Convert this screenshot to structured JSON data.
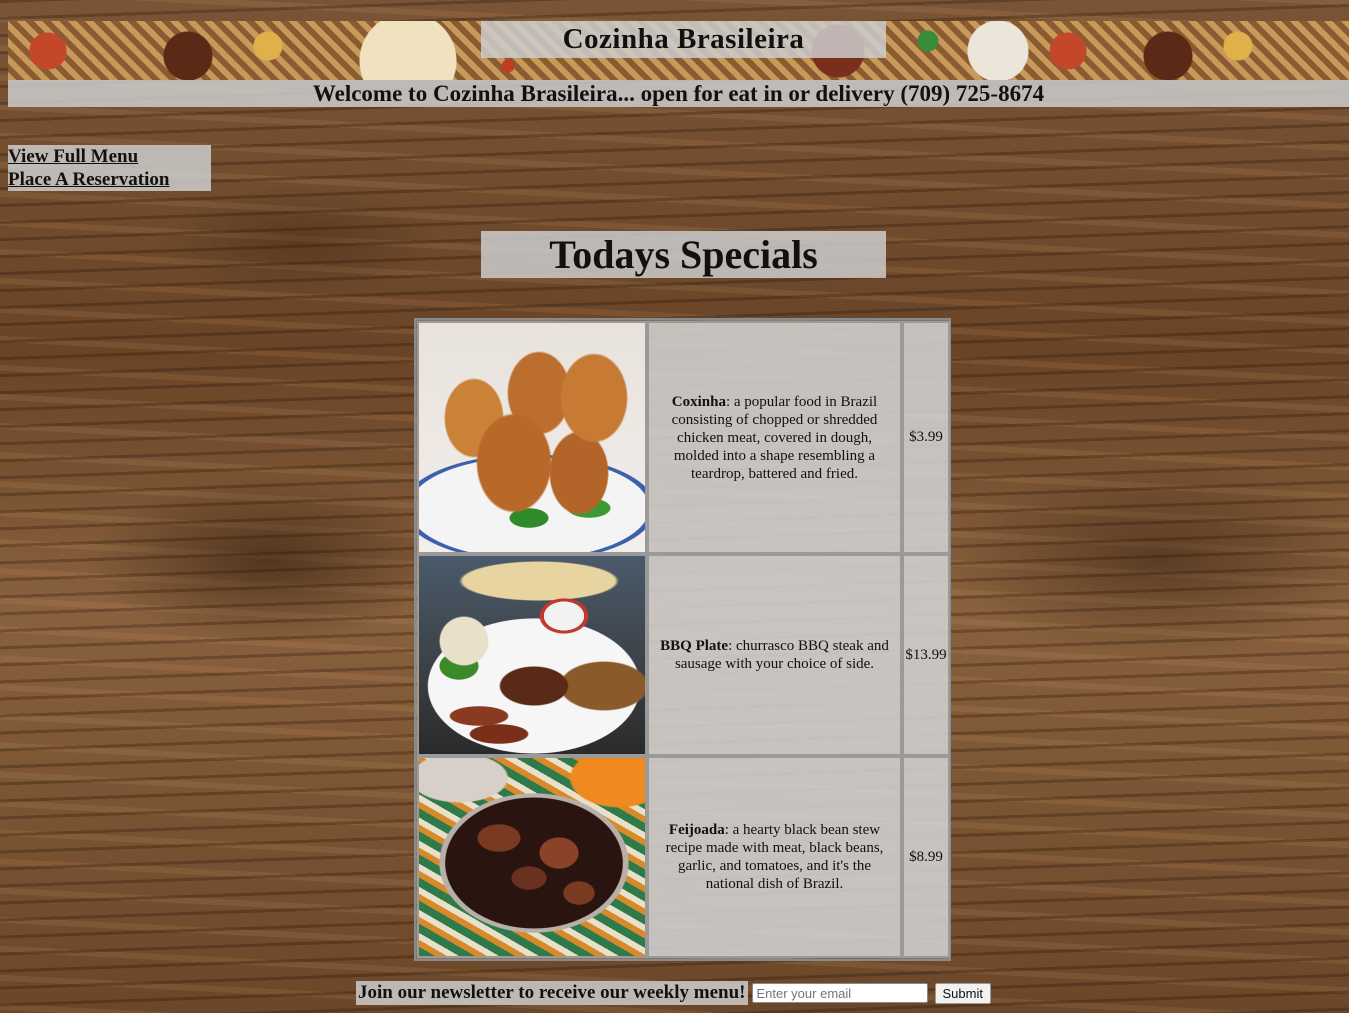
{
  "header": {
    "title": "Cozinha Brasileira",
    "welcome": "Welcome to Cozinha Brasileira... open for eat in or delivery (709) 725-8674"
  },
  "nav": {
    "menu_link": "View Full Menu",
    "reservation_link": "Place A Reservation"
  },
  "specials": {
    "heading": "Todays Specials",
    "items": [
      {
        "name": "Coxinha",
        "description": ": a popular food in Brazil consisting of chopped or shredded chicken meat, covered in dough, molded into a shape resembling a teardrop, battered and fried.",
        "price": "$3.99"
      },
      {
        "name": "BBQ Plate",
        "description": ": churrasco BBQ steak and sausage with your choice of side.",
        "price": "$13.99"
      },
      {
        "name": "Feijoada",
        "description": ": a hearty black bean stew recipe made with meat, black beans, garlic, and tomatoes, and it's the national dish of Brazil.",
        "price": "$8.99"
      }
    ]
  },
  "newsletter": {
    "label": "Join our newsletter to receive our weekly menu!",
    "email_placeholder": "Enter your email",
    "submit_label": "Submit"
  }
}
